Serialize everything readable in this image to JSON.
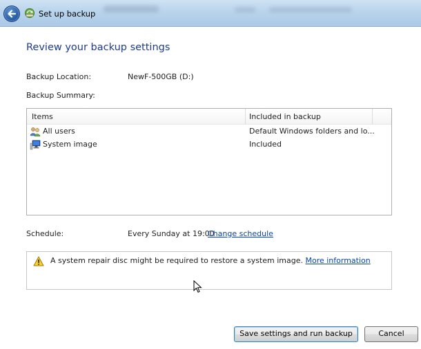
{
  "window": {
    "title": "Set up backup"
  },
  "page": {
    "heading": "Review your backup settings",
    "backup_location_label": "Backup Location:",
    "backup_location_value": "NewF-500GB (D:)",
    "backup_summary_label": "Backup Summary:"
  },
  "summary_table": {
    "columns": [
      "Items",
      "Included in backup"
    ],
    "rows": [
      {
        "icon": "users-icon",
        "item": "All users",
        "included": "Default Windows folders and lo..."
      },
      {
        "icon": "system-image-icon",
        "item": "System image",
        "included": "Included"
      }
    ]
  },
  "schedule": {
    "label": "Schedule:",
    "value": "Every Sunday at 19:00",
    "change_link": "Change schedule"
  },
  "warning": {
    "icon": "warning-icon",
    "text": "A system repair disc might be required to restore a system image.",
    "link": "More information"
  },
  "buttons": {
    "save": "Save settings and run backup",
    "cancel": "Cancel"
  },
  "colors": {
    "heading": "#1e3c8c",
    "link": "#0645ad",
    "titlebar": "#b9d4ec"
  }
}
